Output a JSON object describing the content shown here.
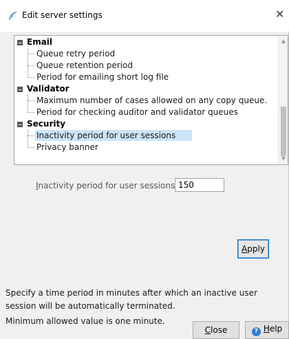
{
  "window": {
    "title": "Edit server settings",
    "close_glyph": "✕"
  },
  "tree": {
    "groups": [
      {
        "label": "Email",
        "items": [
          "Queue retry period",
          "Queue retention period",
          "Period for emailing short log file"
        ]
      },
      {
        "label": "Validator",
        "items": [
          "Maximum number of cases allowed on any copy queue.",
          "Period for checking auditor and validator queues"
        ]
      },
      {
        "label": "Security",
        "items": [
          "Inactivity period for user sessions",
          "Privacy banner"
        ]
      }
    ],
    "selected_item": "Inactivity period for user sessions"
  },
  "setting": {
    "label": "Inactivity period for user sessions",
    "label_accelerator": "I",
    "label_rest": "nactivity period for user sessions",
    "value": "150"
  },
  "buttons": {
    "apply_accelerator": "A",
    "apply_rest": "pply",
    "close_accelerator": "C",
    "close_rest": "lose",
    "help_accelerator": "H",
    "help_rest": "elp"
  },
  "description": {
    "line1": "Specify a time period in minutes after which an inactive user session will be automatically terminated.",
    "line2": "Minimum allowed value is one minute."
  },
  "icons": {
    "app": "wifi-feather-icon",
    "help": "help-circle-icon",
    "expander": "collapse-box-icon"
  },
  "colors": {
    "selection": "#cce4f7",
    "accent": "#1a73c7"
  }
}
